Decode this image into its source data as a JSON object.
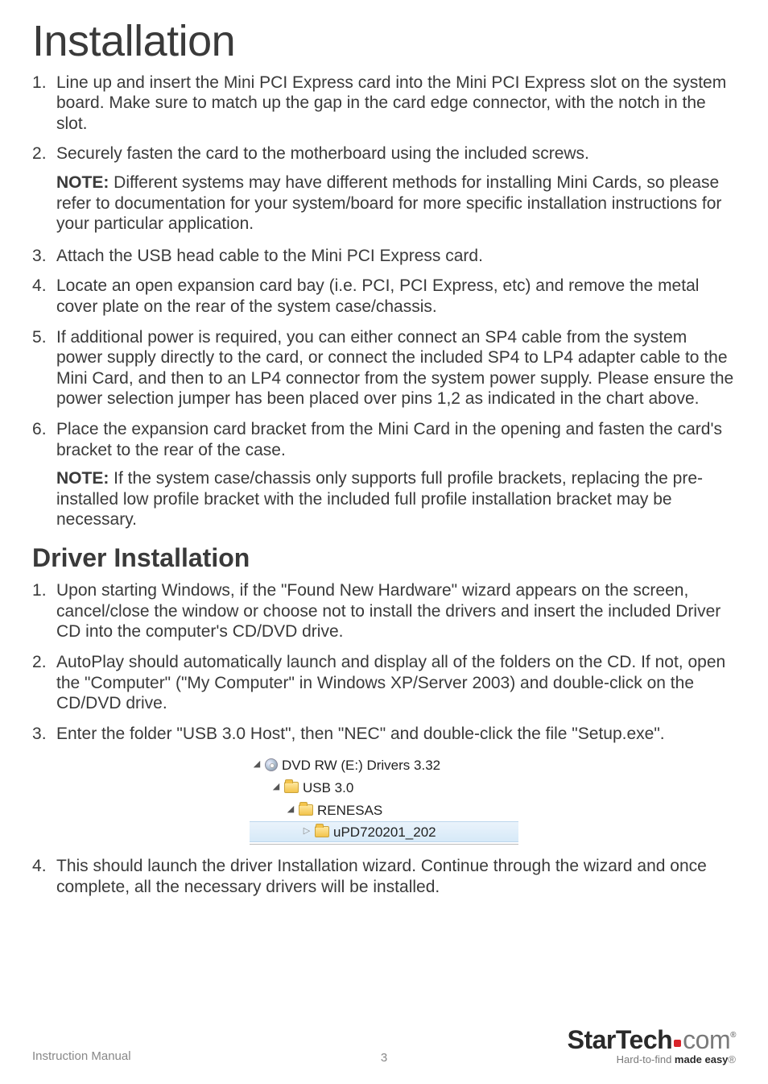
{
  "title": "Installation",
  "steps": [
    "Line up and insert the Mini PCI Express card into the Mini PCI Express slot on the system board. Make sure to match up the gap in the card edge connector, with the notch in the slot.",
    "Securely fasten the card to the motherboard using the included screws.",
    "Attach the USB head cable to the Mini PCI Express card.",
    "Locate an open expansion card bay (i.e. PCI, PCI Express, etc) and remove the metal cover plate on the rear of the system case/chassis.",
    "If additional power is required, you can either connect an SP4 cable from the system power supply directly to the card, or connect the included SP4 to LP4 adapter cable to the Mini Card, and then to an LP4 connector from the system power supply. Please ensure the power selection jumper has been placed over pins 1,2 as indicated in the chart above.",
    "Place the expansion card bracket from the Mini Card in the opening and fasten the card's bracket to the rear of the case."
  ],
  "notes": {
    "label": "NOTE:",
    "after2": "Different systems may have different methods for installing Mini Cards, so please refer to documentation for your system/board for more specific installation instructions for your particular application.",
    "after6": "If the system case/chassis only supports full profile brackets, replacing the pre-installed low profile bracket with the included full profile installation bracket may be necessary."
  },
  "driver": {
    "heading": "Driver Installation",
    "steps": [
      "Upon starting Windows, if the \"Found New Hardware\" wizard appears on the screen, cancel/close the window or choose not to install the drivers and insert the included Driver CD into the computer's CD/DVD drive.",
      "AutoPlay should automatically launch and display all of the folders on the CD. If not, open the \"Computer\" (\"My Computer\" in Windows XP/Server 2003) and double-click on the CD/DVD drive.",
      "Enter the folder \"USB 3.0 Host\", then \"NEC\" and double-click the file \"Setup.exe\".",
      "This should launch the driver Installation wizard. Continue through the wizard and once complete, all the necessary drivers will be installed."
    ]
  },
  "tree": {
    "drive": "DVD RW (E:) Drivers 3.32",
    "l1": "USB 3.0",
    "l2": "RENESAS",
    "l3": "uPD720201_202"
  },
  "footer": {
    "left": "Instruction Manual",
    "page": "3",
    "brand_main": "StarTech",
    "brand_ext": "com",
    "tagline_pre": "Hard-to-find ",
    "tagline_bold": "made easy"
  }
}
